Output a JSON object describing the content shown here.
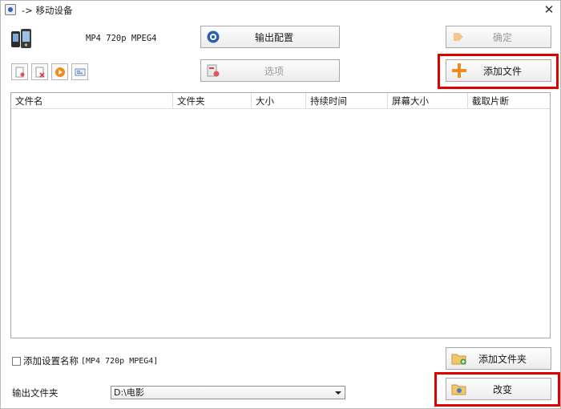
{
  "window": {
    "title": "-> 移动设备",
    "close_glyph": "✕"
  },
  "profile": {
    "label": "MP4 720p MPEG4"
  },
  "buttons": {
    "output_config": "输出配置",
    "options": "选项",
    "confirm": "确定",
    "add_file": "添加文件",
    "add_folder": "添加文件夹",
    "change": "改变"
  },
  "toolbar": {
    "icons": [
      "remove-file-icon",
      "clear-list-icon",
      "play-icon",
      "media-info-icon"
    ]
  },
  "file_list": {
    "columns": [
      "文件名",
      "文件夹",
      "大小",
      "持续时间",
      "屏幕大小",
      "截取片断"
    ],
    "rows": []
  },
  "options": {
    "add_setting_name_label": "添加设置名称",
    "add_setting_name_value": "[MP4 720p MPEG4]",
    "add_setting_name_checked": false
  },
  "output": {
    "label": "输出文件夹",
    "folder": "D:\\电影"
  },
  "colors": {
    "highlight": "#e00000",
    "accent_orange": "#f08c1e"
  }
}
